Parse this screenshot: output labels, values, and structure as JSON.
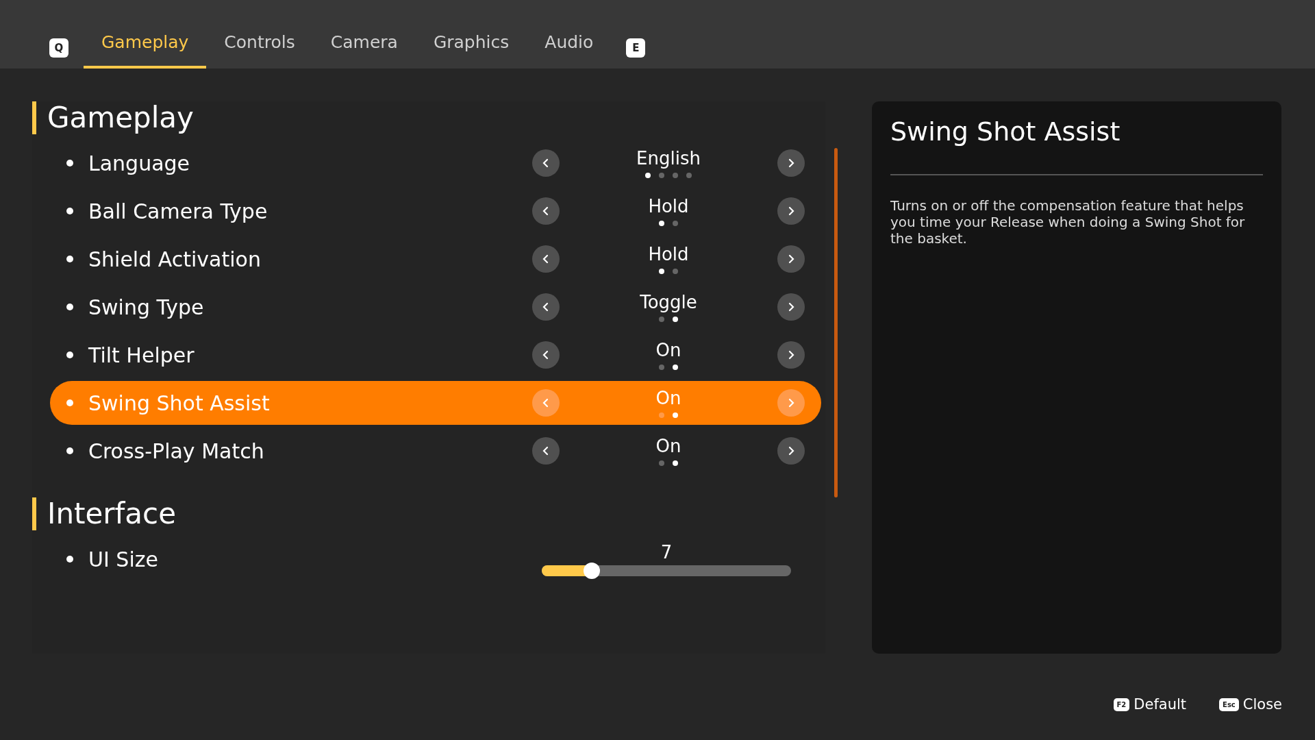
{
  "tabs": {
    "prev_key": "Q",
    "next_key": "E",
    "items": [
      {
        "label": "Gameplay",
        "selected": true
      },
      {
        "label": "Controls",
        "selected": false
      },
      {
        "label": "Camera",
        "selected": false
      },
      {
        "label": "Graphics",
        "selected": false
      },
      {
        "label": "Audio",
        "selected": false
      }
    ]
  },
  "sections": [
    {
      "title": "Gameplay",
      "settings": [
        {
          "kind": "choice",
          "label": "Language",
          "value": "English",
          "selected": false,
          "dots": [
            {
              "selected": true
            },
            {
              "selected": false
            },
            {
              "selected": false
            },
            {
              "selected": false
            }
          ]
        },
        {
          "kind": "choice",
          "label": "Ball Camera Type",
          "value": "Hold",
          "selected": false,
          "dots": [
            {
              "selected": true
            },
            {
              "selected": false
            }
          ]
        },
        {
          "kind": "choice",
          "label": "Shield Activation",
          "value": "Hold",
          "selected": false,
          "dots": [
            {
              "selected": true
            },
            {
              "selected": false
            }
          ]
        },
        {
          "kind": "choice",
          "label": "Swing Type",
          "value": "Toggle",
          "selected": false,
          "dots": [
            {
              "selected": false
            },
            {
              "selected": true
            }
          ]
        },
        {
          "kind": "choice",
          "label": "Tilt Helper",
          "value": "On",
          "selected": false,
          "dots": [
            {
              "selected": false
            },
            {
              "selected": true
            }
          ]
        },
        {
          "kind": "choice",
          "label": "Swing Shot Assist",
          "value": "On",
          "selected": true,
          "dots": [
            {
              "selected": false
            },
            {
              "selected": true
            }
          ]
        },
        {
          "kind": "choice",
          "label": "Cross-Play Match",
          "value": "On",
          "selected": false,
          "dots": [
            {
              "selected": false
            },
            {
              "selected": true
            }
          ]
        }
      ]
    },
    {
      "title": "Interface",
      "settings": [
        {
          "kind": "slider",
          "label": "UI Size",
          "value": "7",
          "selected": false,
          "level": 0.2
        }
      ]
    }
  ],
  "detail": {
    "title": "Swing Shot Assist",
    "description": "Turns on or off the compensation feature that helps you time your Release when doing a Swing Shot for the basket."
  },
  "footer": [
    {
      "key": "F2",
      "label": "Default"
    },
    {
      "key": "Esc",
      "label": "Close"
    }
  ]
}
